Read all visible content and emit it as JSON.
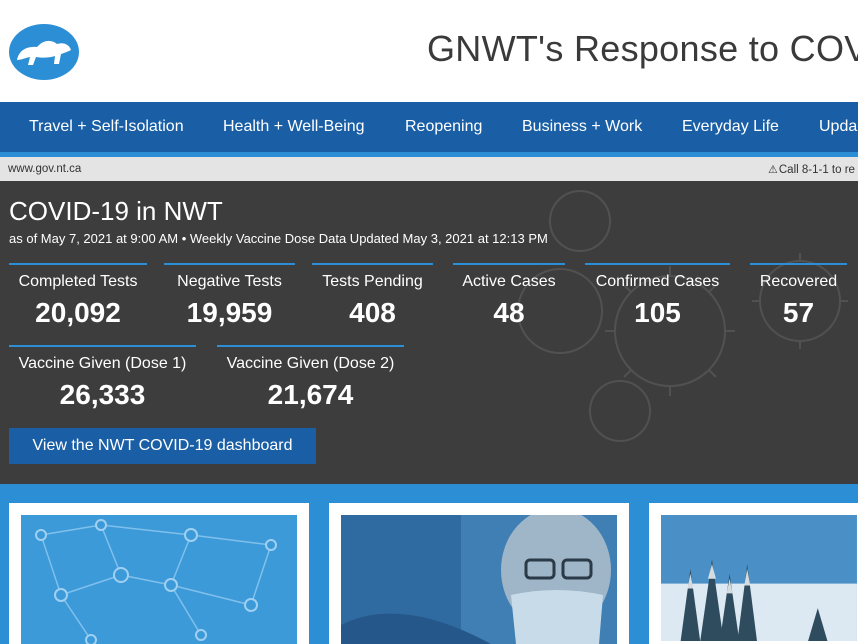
{
  "header": {
    "title": "GNWT's Response to COV",
    "logo_icon": "polar-bear-icon"
  },
  "nav": {
    "items": [
      {
        "label": "Travel + Self-Isolation"
      },
      {
        "label": "Health + Well-Being"
      },
      {
        "label": "Reopening"
      },
      {
        "label": "Business + Work"
      },
      {
        "label": "Everyday Life"
      },
      {
        "label": "Upda"
      }
    ]
  },
  "infobar": {
    "domain": "www.gov.nt.ca",
    "call_text": "Call 8-1-1 to re",
    "warning_icon": "warning-icon"
  },
  "covid": {
    "title": "COVID-19 in NWT",
    "subtitle": "as of May 7, 2021 at 9:00 AM • Weekly Vaccine Dose Data Updated May 3, 2021 at 12:13 PM",
    "stats": [
      {
        "label": "Completed Tests",
        "value": "20,092"
      },
      {
        "label": "Negative Tests",
        "value": "19,959"
      },
      {
        "label": "Tests Pending",
        "value": "408"
      },
      {
        "label": "Active Cases",
        "value": "48"
      },
      {
        "label": "Confirmed Cases",
        "value": "105"
      },
      {
        "label": "Recovered",
        "value": "57"
      },
      {
        "label": "Vaccine Given (Dose 1)",
        "value": "26,333"
      },
      {
        "label": "Vaccine Given (Dose 2)",
        "value": "21,674"
      }
    ],
    "dashboard_button": "View the NWT COVID-19 dashboard"
  },
  "colors": {
    "nav_blue": "#1a5fa6",
    "accent_blue": "#2c8fd6",
    "panel_dark": "#3d3d3d"
  }
}
